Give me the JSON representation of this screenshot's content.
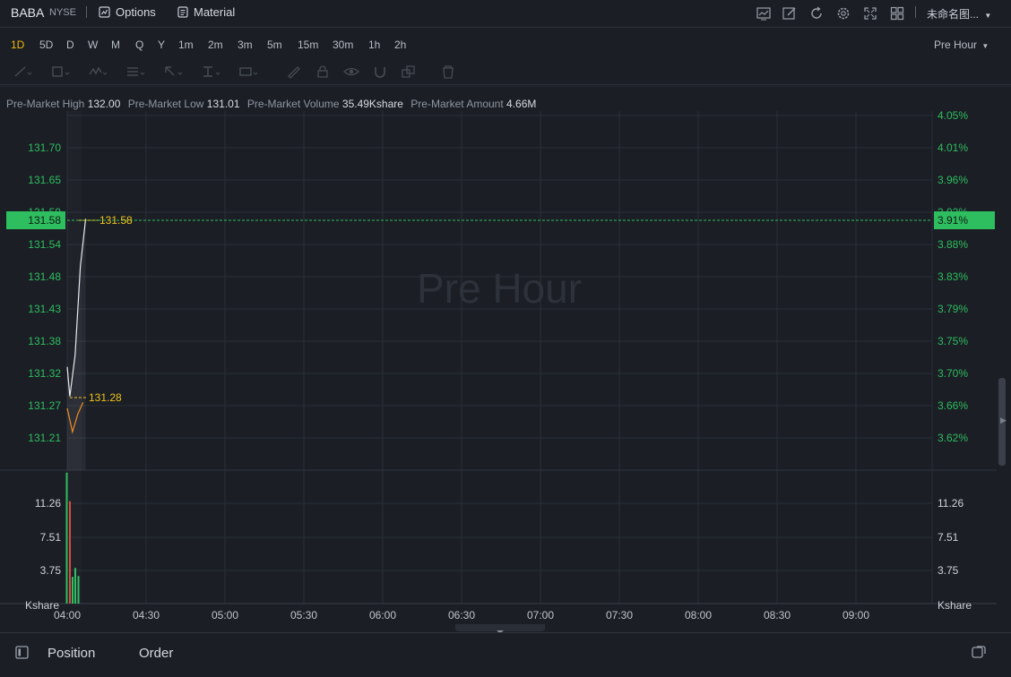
{
  "header": {
    "symbol": "BABA",
    "exchange": "NYSE",
    "options_label": "Options",
    "material_label": "Material",
    "layout_name": "未命名图...",
    "icons": [
      "chart-line-icon",
      "edit-icon",
      "refresh-icon",
      "settings-icon",
      "fullscreen-icon",
      "grid-icon"
    ]
  },
  "intervals": [
    "1D",
    "5D",
    "D",
    "W",
    "M",
    "Q",
    "Y",
    "1m",
    "2m",
    "3m",
    "5m",
    "15m",
    "30m",
    "1h",
    "2h"
  ],
  "active_interval": "1D",
  "session_select": "Pre Hour",
  "stats": {
    "high_label": "Pre-Market High",
    "high_value": "132.00",
    "low_label": "Pre-Market Low",
    "low_value": "131.01",
    "volume_label": "Pre-Market Volume",
    "volume_value": "35.49Kshare",
    "amount_label": "Pre-Market Amount",
    "amount_value": "4.66M"
  },
  "watermark": "Pre Hour",
  "chart_data": {
    "type": "line",
    "price_axis_left": [
      "131.70",
      "131.65",
      "131.59",
      "131.54",
      "131.48",
      "131.43",
      "131.38",
      "131.32",
      "131.27",
      "131.21"
    ],
    "price_axis_right": [
      "4.05%",
      "4.01%",
      "3.96%",
      "3.92%",
      "3.88%",
      "3.83%",
      "3.79%",
      "3.75%",
      "3.70%",
      "3.66%",
      "3.62%"
    ],
    "current_price": "131.58",
    "current_pct": "3.91%",
    "high_marker": "131.58",
    "low_marker": "131.28",
    "price_series": [
      {
        "t": "04:00",
        "v": 131.33
      },
      {
        "t": "04:01",
        "v": 131.28
      },
      {
        "t": "04:03",
        "v": 131.35
      },
      {
        "t": "04:05",
        "v": 131.5
      },
      {
        "t": "04:07",
        "v": 131.58
      }
    ],
    "avg_series": [
      {
        "t": "04:00",
        "v": 131.26
      },
      {
        "t": "04:02",
        "v": 131.22
      },
      {
        "t": "04:04",
        "v": 131.25
      },
      {
        "t": "04:06",
        "v": 131.27
      }
    ],
    "volume_axis": [
      "11.26",
      "7.51",
      "3.75"
    ],
    "volume_unit": "Kshare",
    "volume_bars": [
      {
        "t": "04:00",
        "v": 14.7,
        "color": "green"
      },
      {
        "t": "04:01",
        "v": 11.5,
        "color": "red"
      },
      {
        "t": "04:03",
        "v": 3.0,
        "color": "green"
      },
      {
        "t": "04:04",
        "v": 4.0,
        "color": "green"
      },
      {
        "t": "04:05",
        "v": 3.1,
        "color": "green"
      }
    ],
    "x_ticks": [
      "04:00",
      "04:30",
      "05:00",
      "05:30",
      "06:00",
      "06:30",
      "07:00",
      "07:30",
      "08:00",
      "08:30",
      "09:00"
    ],
    "colors": {
      "up": "#2ebd5f",
      "down": "#e0433b",
      "price_line": "#e8eaed",
      "avg_line": "#f08c1e",
      "grid": "#2a2f38",
      "axis_text_green": "#2ebd5f",
      "marker": "#f0c419"
    }
  },
  "bottom": {
    "position_label": "Position",
    "order_label": "Order"
  }
}
